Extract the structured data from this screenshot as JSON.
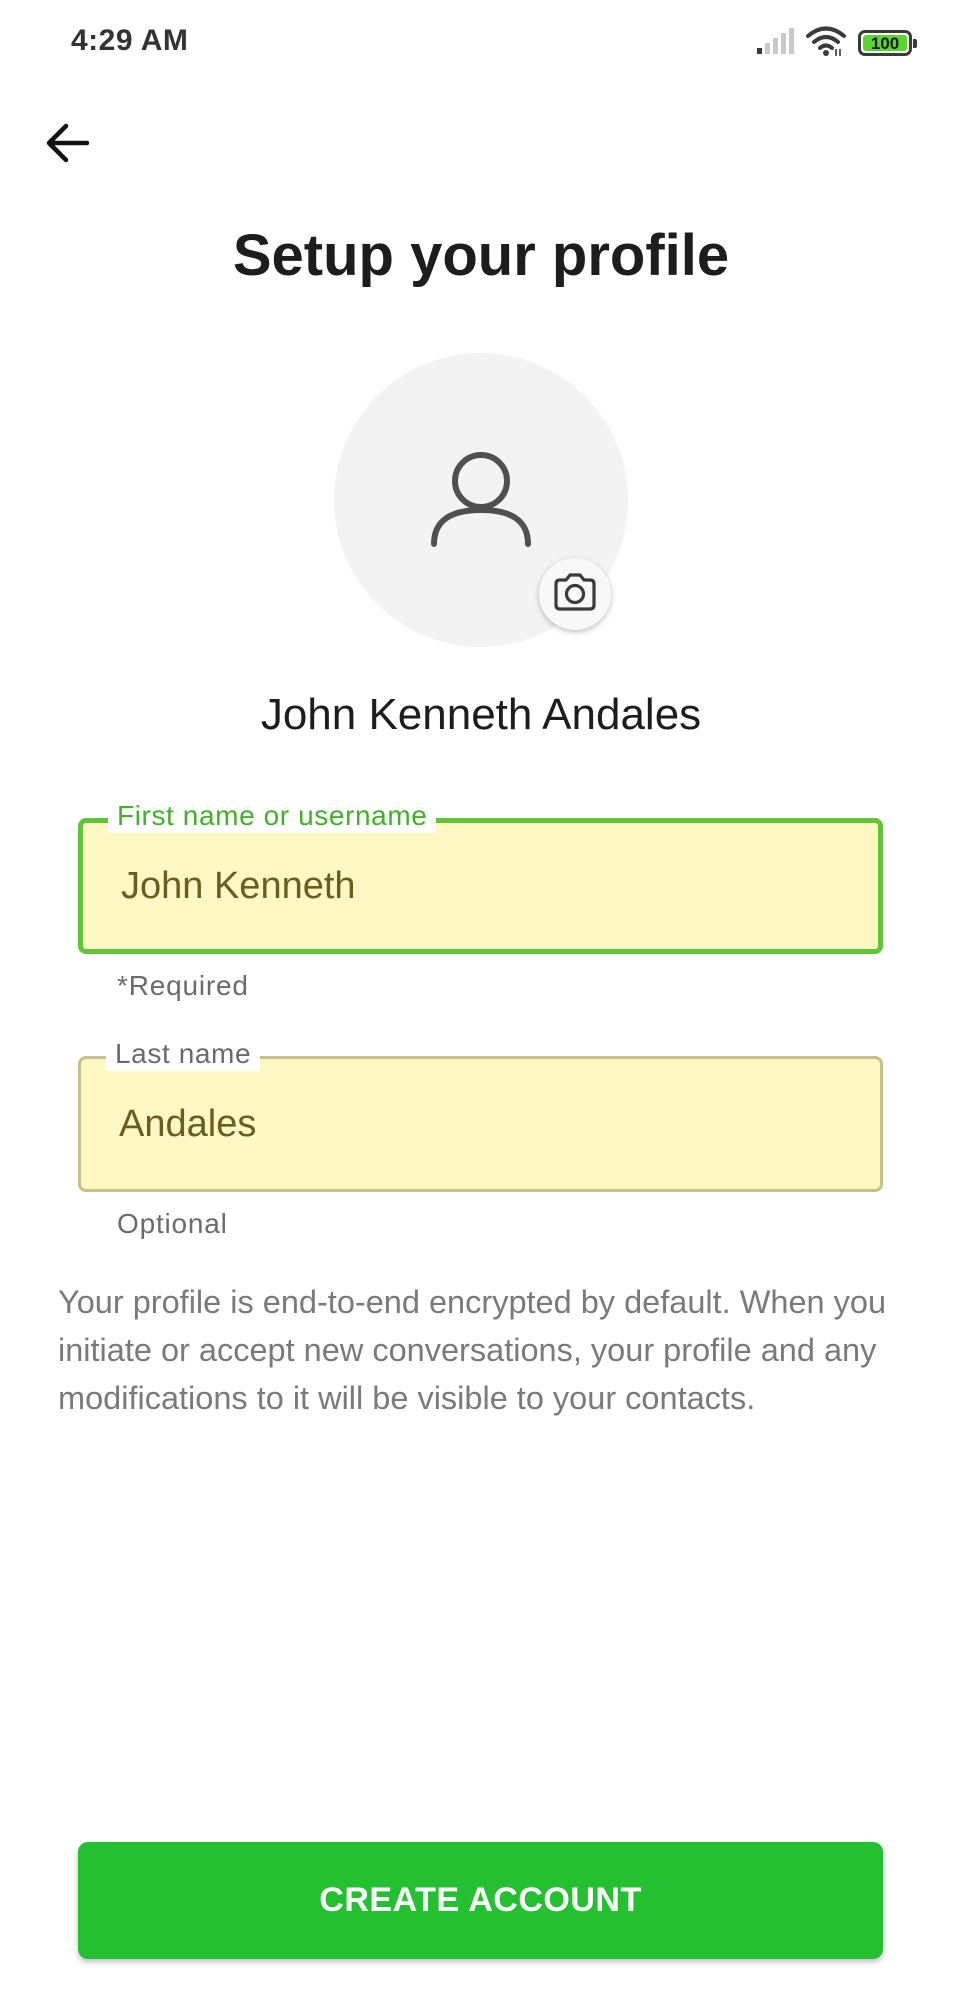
{
  "status_bar": {
    "time": "4:29 AM",
    "battery_level": "100",
    "icons": [
      "signal-icon",
      "wifi-icon",
      "battery-icon"
    ]
  },
  "header": {
    "back_icon": "back-arrow-icon",
    "title": "Setup your profile"
  },
  "avatar": {
    "icon": "person-icon",
    "camera_icon": "camera-icon"
  },
  "profile": {
    "display_name": "John Kenneth Andales"
  },
  "form": {
    "first_name": {
      "label": "First name or username",
      "value": "John Kenneth",
      "helper": "*Required"
    },
    "last_name": {
      "label": "Last name",
      "value": "Andales",
      "helper": "Optional"
    }
  },
  "info": {
    "text": "Your profile is end-to-end encrypted by default. When you initiate or accept new conversations, your profile and any modifications to it will be visible to your contacts."
  },
  "actions": {
    "create_label": "CREATE ACCOUNT"
  },
  "colors": {
    "accent": "#25c032",
    "focus_border": "#63c43a",
    "field_background": "#fff8c4"
  }
}
